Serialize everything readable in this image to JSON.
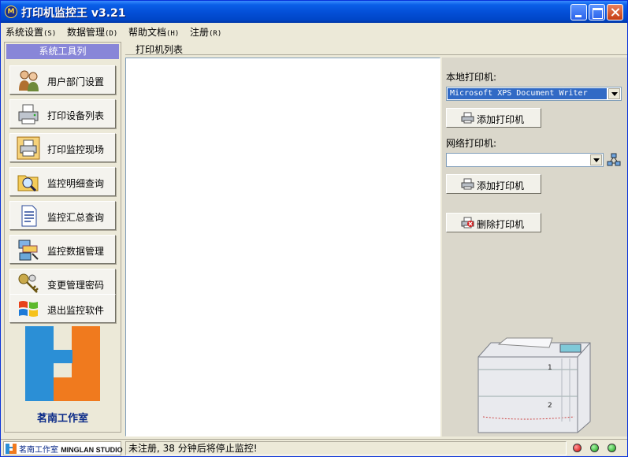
{
  "window": {
    "app_icon_text": "M",
    "title": "打印机监控王 v3.21"
  },
  "menubar": {
    "items": [
      {
        "label": "系统设置",
        "key": "(S)"
      },
      {
        "label": "数据管理",
        "key": "(D)"
      },
      {
        "label": "帮助文档",
        "key": "(H)"
      },
      {
        "label": "注册",
        "key": "(R)"
      }
    ]
  },
  "sidebar": {
    "header": "系统工具列",
    "tools": [
      {
        "label": "用户部门设置",
        "icon": "users-icon"
      },
      {
        "label": "打印设备列表",
        "icon": "printer-icon"
      },
      {
        "label": "打印监控现场",
        "icon": "printer-monitor-icon"
      },
      {
        "label": "监控明细查询",
        "icon": "folder-search-icon"
      },
      {
        "label": "监控汇总查询",
        "icon": "document-icon"
      },
      {
        "label": "监控数据管理",
        "icon": "data-management-icon"
      },
      {
        "label": "变更管理密码",
        "icon": "keys-icon"
      },
      {
        "label": "退出监控软件",
        "icon": "windows-logo-icon"
      }
    ],
    "studio_name": "茗南工作室"
  },
  "tabs": {
    "printer_list": "打印机列表"
  },
  "right_panel": {
    "local_label": "本地打印机:",
    "local_selected": "Microsoft XPS Document Writer",
    "add_local_button": "添加打印机",
    "network_label": "网络打印机:",
    "network_selected": "",
    "add_network_button": "添加打印机",
    "delete_button": "删除打印机"
  },
  "statusbar": {
    "logo_cn": "茗南工作室",
    "logo_en": "MINGLAN STUDIO",
    "message": "未注册, 38 分钟后将停止监控!"
  },
  "colors": {
    "titlebar": "#0450D8",
    "sidebar_header": "#8886D8",
    "logo_blue": "#2B8FD6",
    "logo_orange": "#F07A1E",
    "selection": "#316AC5"
  }
}
